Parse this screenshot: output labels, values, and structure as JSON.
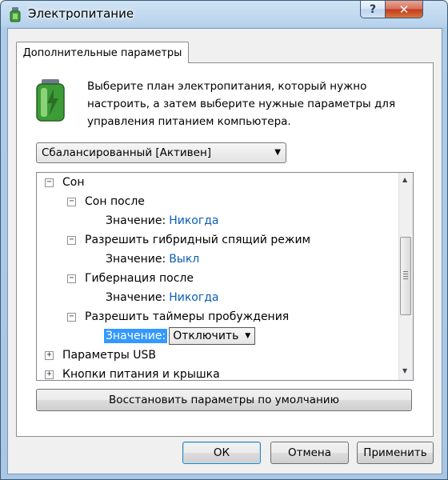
{
  "window": {
    "title": "Электропитание"
  },
  "titlebar": {
    "help_label": "?",
    "close_label": "✕"
  },
  "tab": {
    "label": "Дополнительные параметры"
  },
  "description": "Выберите план электропитания, который нужно настроить, а затем выберите нужные параметры для управления питанием компьютера.",
  "plan": {
    "selected": "Сбалансированный [Активен]"
  },
  "tree": {
    "sleep": {
      "label": "Сон",
      "expander": "−",
      "sleep_after": {
        "label": "Сон после",
        "value_label": "Значение:",
        "value": "Никогда"
      },
      "hybrid": {
        "label": "Разрешить гибридный спящий режим",
        "value_label": "Значение:",
        "value": "Выкл"
      },
      "hibernate": {
        "label": "Гибернация после",
        "value_label": "Значение:",
        "value": "Никогда"
      },
      "wake_timers": {
        "label": "Разрешить таймеры пробуждения",
        "value_label": "Значение:",
        "value": "Отключить"
      }
    },
    "usb": {
      "label": "Параметры USB",
      "expander": "+"
    },
    "power_buttons": {
      "label": "Кнопки питания и крышка",
      "expander": "+"
    }
  },
  "restore_button": "Восстановить параметры по умолчанию",
  "buttons": {
    "ok": "ОК",
    "cancel": "Отмена",
    "apply": "Применить"
  },
  "colors": {
    "link": "#0b5fb5",
    "selection": "#3399ff"
  }
}
